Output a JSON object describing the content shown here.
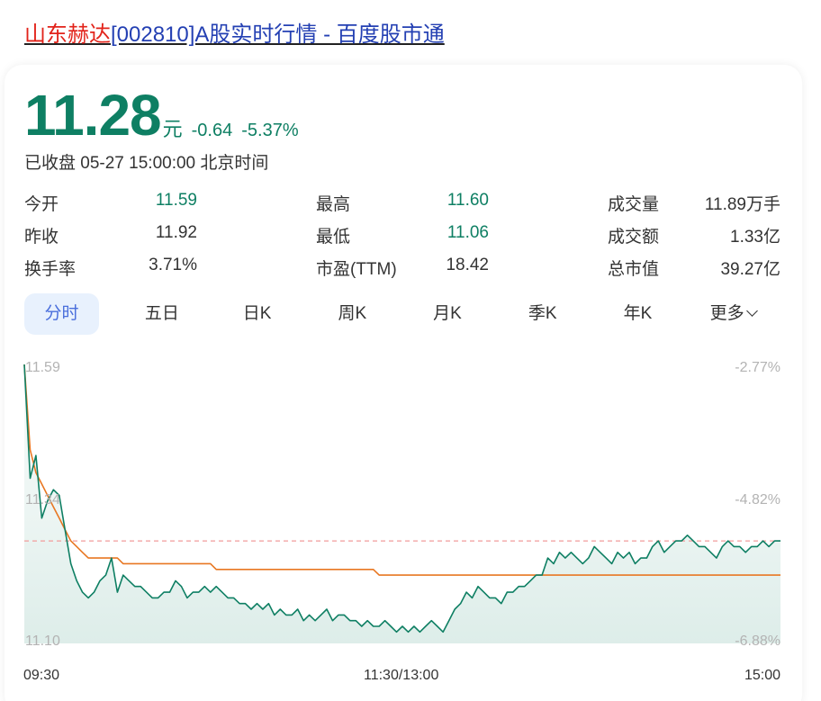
{
  "title": {
    "stock_name": "山东赫达",
    "rest": "[002810]A股实时行情 - 百度股市通"
  },
  "quote": {
    "price": "11.28",
    "unit": "元",
    "change": "-0.64",
    "change_pct": "-5.37%",
    "status": "已收盘 05-27 15:00:00 北京时间"
  },
  "stats": [
    [
      {
        "label": "今开",
        "value": "11.59",
        "green": true
      },
      {
        "label": "最高",
        "value": "11.60",
        "green": true
      },
      {
        "label": "成交量",
        "value": "11.89万手",
        "green": false
      }
    ],
    [
      {
        "label": "昨收",
        "value": "11.92",
        "green": false
      },
      {
        "label": "最低",
        "value": "11.06",
        "green": true
      },
      {
        "label": "成交额",
        "value": "1.33亿",
        "green": false
      }
    ],
    [
      {
        "label": "换手率",
        "value": "3.71%",
        "green": false
      },
      {
        "label": "市盈(TTM)",
        "value": "18.42",
        "green": false
      },
      {
        "label": "总市值",
        "value": "39.27亿",
        "green": false
      }
    ]
  ],
  "tabs": [
    "分时",
    "五日",
    "日K",
    "周K",
    "月K",
    "季K",
    "年K",
    "更多"
  ],
  "colors": {
    "green": "#0e7f63",
    "avg_line": "#e87722",
    "prev_close_line": "#f29c9c",
    "tab_active_bg": "#e8f1fd",
    "tab_active_text": "#4a6fdc"
  },
  "chart_data": {
    "type": "area",
    "y_left_labels": [
      "11.59",
      "11.34",
      "11.10"
    ],
    "y_right_labels": [
      "-2.77%",
      "-4.82%",
      "-6.88%"
    ],
    "x_labels": [
      "09:30",
      "11:30/13:00",
      "15:00"
    ],
    "ylim": [
      11.1,
      11.59
    ],
    "prev_close_ref": 11.28,
    "price": [
      11.59,
      11.39,
      11.43,
      11.32,
      11.35,
      11.37,
      11.36,
      11.3,
      11.24,
      11.21,
      11.19,
      11.18,
      11.19,
      11.21,
      11.22,
      11.25,
      11.19,
      11.22,
      11.21,
      11.2,
      11.2,
      11.19,
      11.18,
      11.18,
      11.19,
      11.19,
      11.21,
      11.2,
      11.18,
      11.19,
      11.19,
      11.2,
      11.19,
      11.2,
      11.19,
      11.18,
      11.18,
      11.17,
      11.17,
      11.16,
      11.17,
      11.16,
      11.17,
      11.15,
      11.16,
      11.15,
      11.15,
      11.16,
      11.14,
      11.15,
      11.14,
      11.15,
      11.16,
      11.14,
      11.15,
      11.15,
      11.14,
      11.14,
      11.13,
      11.14,
      11.13,
      11.13,
      11.14,
      11.13,
      11.12,
      11.13,
      11.12,
      11.13,
      11.12,
      11.13,
      11.14,
      11.13,
      11.12,
      11.14,
      11.16,
      11.17,
      11.19,
      11.18,
      11.2,
      11.19,
      11.18,
      11.18,
      11.17,
      11.19,
      11.19,
      11.2,
      11.2,
      11.21,
      11.22,
      11.22,
      11.25,
      11.24,
      11.26,
      11.25,
      11.26,
      11.25,
      11.24,
      11.25,
      11.27,
      11.26,
      11.25,
      11.24,
      11.26,
      11.25,
      11.26,
      11.24,
      11.25,
      11.25,
      11.27,
      11.28,
      11.26,
      11.27,
      11.28,
      11.28,
      11.29,
      11.28,
      11.27,
      11.27,
      11.26,
      11.25,
      11.27,
      11.28,
      11.27,
      11.27,
      11.26,
      11.27,
      11.27,
      11.28,
      11.27,
      11.28,
      11.28
    ],
    "avg_price": [
      11.59,
      11.44,
      11.4,
      11.38,
      11.36,
      11.34,
      11.32,
      11.3,
      11.28,
      11.27,
      11.26,
      11.25,
      11.25,
      11.25,
      11.25,
      11.25,
      11.25,
      11.24,
      11.24,
      11.24,
      11.24,
      11.24,
      11.24,
      11.24,
      11.24,
      11.24,
      11.24,
      11.24,
      11.24,
      11.24,
      11.24,
      11.24,
      11.24,
      11.23,
      11.23,
      11.23,
      11.23,
      11.23,
      11.23,
      11.23,
      11.23,
      11.23,
      11.23,
      11.23,
      11.23,
      11.23,
      11.23,
      11.23,
      11.23,
      11.23,
      11.23,
      11.23,
      11.23,
      11.23,
      11.23,
      11.23,
      11.23,
      11.23,
      11.23,
      11.23,
      11.23,
      11.22,
      11.22,
      11.22,
      11.22,
      11.22,
      11.22,
      11.22,
      11.22,
      11.22,
      11.22,
      11.22,
      11.22,
      11.22,
      11.22,
      11.22,
      11.22,
      11.22,
      11.22,
      11.22,
      11.22,
      11.22,
      11.22,
      11.22,
      11.22,
      11.22,
      11.22,
      11.22,
      11.22,
      11.22,
      11.22,
      11.22,
      11.22,
      11.22,
      11.22,
      11.22,
      11.22,
      11.22,
      11.22,
      11.22,
      11.22,
      11.22,
      11.22,
      11.22,
      11.22,
      11.22,
      11.22,
      11.22,
      11.22,
      11.22,
      11.22,
      11.22,
      11.22,
      11.22,
      11.22,
      11.22,
      11.22,
      11.22,
      11.22,
      11.22,
      11.22,
      11.22,
      11.22,
      11.22,
      11.22,
      11.22,
      11.22,
      11.22,
      11.22,
      11.22,
      11.22
    ]
  }
}
